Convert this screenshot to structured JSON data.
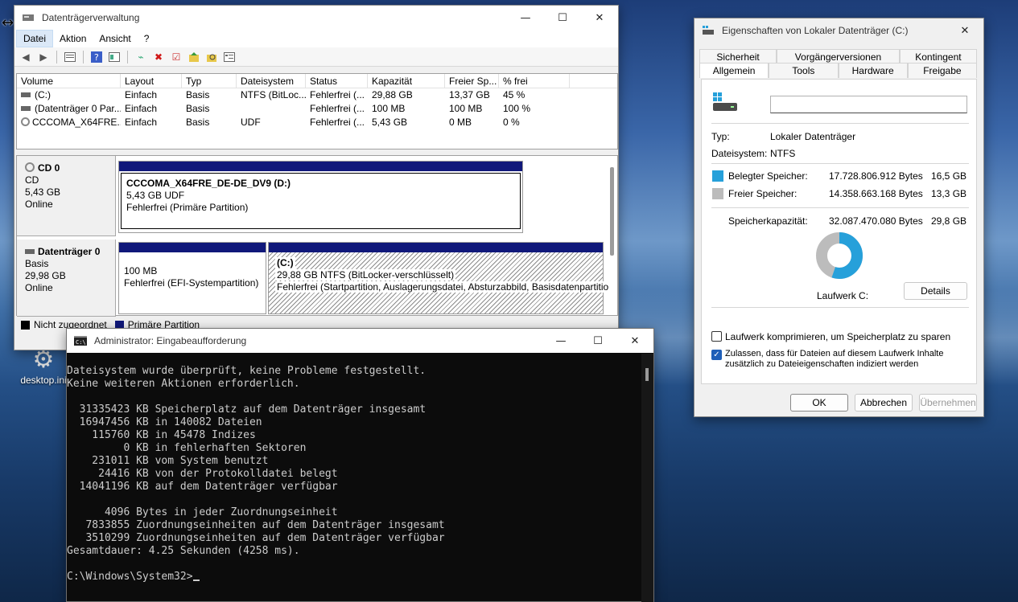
{
  "disk_mgmt": {
    "title": "Datenträgerverwaltung",
    "menu": [
      "Datei",
      "Aktion",
      "Ansicht",
      "?"
    ],
    "columns": [
      "Volume",
      "Layout",
      "Typ",
      "Dateisystem",
      "Status",
      "Kapazität",
      "Freier Sp...",
      "% frei"
    ],
    "rows": [
      [
        "(C:)",
        "Einfach",
        "Basis",
        "NTFS (BitLoc...",
        "Fehlerfrei (...",
        "29,88 GB",
        "13,37 GB",
        "45 %"
      ],
      [
        "(Datenträger 0 Par...",
        "Einfach",
        "Basis",
        "",
        "Fehlerfrei (...",
        "100 MB",
        "100 MB",
        "100 %"
      ],
      [
        "CCCOMA_X64FRE...",
        "Einfach",
        "Basis",
        "UDF",
        "Fehlerfrei (...",
        "5,43 GB",
        "0 MB",
        "0 %"
      ]
    ],
    "cd0": {
      "name": "CD 0",
      "type": "CD",
      "size": "5,43 GB",
      "state": "Online",
      "part_name": "CCCOMA_X64FRE_DE-DE_DV9  (D:)",
      "part_size": "5,43 GB UDF",
      "part_status": "Fehlerfrei (Primäre Partition)"
    },
    "disk0": {
      "name": "Datenträger 0",
      "type": "Basis",
      "size": "29,98 GB",
      "state": "Online",
      "p1_size": "100 MB",
      "p1_status": "Fehlerfrei (EFI-Systempartition)",
      "p2_name": "(C:)",
      "p2_size": "29,88 GB NTFS (BitLocker-verschlüsselt)",
      "p2_status": "Fehlerfrei (Startpartition, Auslagerungsdatei, Absturzabbild, Basisdatenpartitio"
    },
    "legend": [
      "Nicht zugeordnet",
      "Primäre Partition"
    ]
  },
  "props": {
    "title": "Eigenschaften von Lokaler Datenträger (C:)",
    "tabs_row1": [
      "Sicherheit",
      "Vorgängerversionen",
      "Kontingent"
    ],
    "tabs_row2": [
      "Allgemein",
      "Tools",
      "Hardware",
      "Freigabe"
    ],
    "name_value": "",
    "type_label": "Typ:",
    "type_value": "Lokaler Datenträger",
    "fs_label": "Dateisystem:",
    "fs_value": "NTFS",
    "used_label": "Belegter Speicher:",
    "used_bytes": "17.728.806.912 Bytes",
    "used_gb": "16,5 GB",
    "free_label": "Freier Speicher:",
    "free_bytes": "14.358.663.168 Bytes",
    "free_gb": "13,3 GB",
    "cap_label": "Speicherkapazität:",
    "cap_bytes": "32.087.470.080 Bytes",
    "cap_gb": "29,8 GB",
    "used_fraction": 0.5525,
    "drive_label": "Laufwerk C:",
    "details_button": "Details",
    "compress_label": "Laufwerk komprimieren, um Speicherplatz zu sparen",
    "index_label_1": "Zulassen, dass für Dateien auf diesem Laufwerk Inhalte",
    "index_label_2": "zusätzlich zu Dateieigenschaften indiziert werden",
    "ok": "OK",
    "cancel": "Abbrechen",
    "apply": "Übernehmen",
    "colors": {
      "used": "#26a0da",
      "free": "#bcbcbc"
    }
  },
  "cmd": {
    "title": "Administrator: Eingabeaufforderung",
    "lines": [
      "Dateisystem wurde überprüft, keine Probleme festgestellt.",
      "Keine weiteren Aktionen erforderlich.",
      "",
      "  31335423 KB Speicherplatz auf dem Datenträger insgesamt",
      "  16947456 KB in 140082 Dateien",
      "    115760 KB in 45478 Indizes",
      "         0 KB in fehlerhaften Sektoren",
      "    231011 KB vom System benutzt",
      "     24416 KB von der Protokolldatei belegt",
      "  14041196 KB auf dem Datenträger verfügbar",
      "",
      "      4096 Bytes in jeder Zuordnungseinheit",
      "   7833855 Zuordnungseinheiten auf dem Datenträger insgesamt",
      "   3510299 Zuordnungseinheiten auf dem Datenträger verfügbar",
      "Gesamtdauer: 4.25 Sekunden (4258 ms).",
      ""
    ],
    "prompt": "C:\\Windows\\System32>"
  },
  "desktop": {
    "icon_label": "desktop.ini"
  }
}
